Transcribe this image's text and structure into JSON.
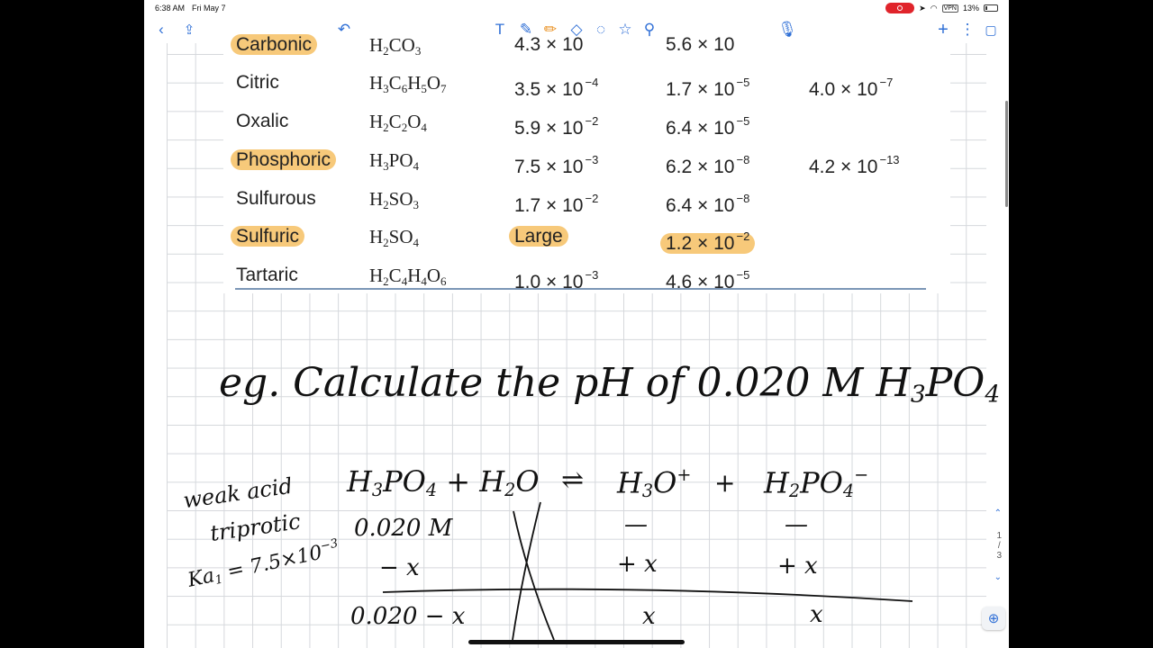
{
  "status": {
    "time": "6:38 AM",
    "date": "Fri May 7",
    "vpn": "VPN",
    "battery": "13%"
  },
  "toolbar": {
    "icons": [
      "back-icon",
      "share-icon",
      "undo-icon",
      "text-tool-icon",
      "pen-icon",
      "highlighter-icon",
      "eraser-icon",
      "lasso-icon",
      "shapes-icon",
      "link-icon",
      "microphone-icon",
      "add-icon",
      "more-icon",
      "pages-icon"
    ]
  },
  "table": {
    "rows": [
      {
        "name": "Carbonic",
        "formula": "H<sub>2</sub>CO<sub>3</sub>",
        "ka1": "4.3 × 10",
        "ka2": "5.6 × 10",
        "ka3": "",
        "hl_name": true
      },
      {
        "name": "Citric",
        "formula": "H<sub>3</sub>C<sub>6</sub>H<sub>5</sub>O<sub>7</sub>",
        "ka1": "3.5 × 10<sup>−4</sup>",
        "ka2": "1.7 × 10<sup>−5</sup>",
        "ka3": "4.0 × 10<sup>−7</sup>"
      },
      {
        "name": "Oxalic",
        "formula": "H<sub>2</sub>C<sub>2</sub>O<sub>4</sub>",
        "ka1": "5.9 × 10<sup>−2</sup>",
        "ka2": "6.4 × 10<sup>−5</sup>",
        "ka3": ""
      },
      {
        "name": "Phosphoric",
        "formula": "H<sub>3</sub>PO<sub>4</sub>",
        "ka1": "7.5 × 10<sup>−3</sup>",
        "ka2": "6.2 × 10<sup>−8</sup>",
        "ka3": "4.2 × 10<sup>−13</sup>",
        "hl_name": true
      },
      {
        "name": "Sulfurous",
        "formula": "H<sub>2</sub>SO<sub>3</sub>",
        "ka1": "1.7 × 10<sup>−2</sup>",
        "ka2": "6.4 × 10<sup>−8</sup>",
        "ka3": ""
      },
      {
        "name": "Sulfuric",
        "formula": "H<sub>2</sub>SO<sub>4</sub>",
        "ka1": "Large",
        "ka2": "1.2 × 10<sup>−2</sup>",
        "ka3": "",
        "hl_name": true,
        "hl_ka1": true,
        "hl_ka2": true
      },
      {
        "name": "Tartaric",
        "formula": "H<sub>2</sub>C<sub>4</sub>H<sub>4</sub>O<sub>6</sub>",
        "ka1": "1.0 × 10<sup>−3</sup>",
        "ka2": "4.6 × 10<sup>−5</sup>",
        "ka3": ""
      }
    ]
  },
  "notes": {
    "title": "eg. Calculate the pH of 0.020 M H<sub>3</sub>PO<sub>4</sub>",
    "side1": "weak acid",
    "side2": "triprotic",
    "side3": "Ka<sub>1</sub> = 7.5×10<sup>−3</sup>",
    "eq_reactant": "H<sub>3</sub>PO<sub>4</sub> + H<sub>2</sub>O",
    "eq_arrow": "⇌",
    "eq_p1": "H<sub>3</sub>O<sup>+</sup>",
    "eq_plus": "+",
    "eq_p2": "H<sub>2</sub>PO<sub>4</sub><sup>−</sup>",
    "i_reactant": "0.020 M",
    "i_p1": "—",
    "i_p2": "—",
    "c_reactant": "− x",
    "c_p1": "+ x",
    "c_p2": "+ x",
    "e_reactant": "0.020 − x",
    "e_p1": "x",
    "e_p2": "x"
  },
  "pager": {
    "current": "1",
    "sep": "/",
    "total": "3"
  }
}
